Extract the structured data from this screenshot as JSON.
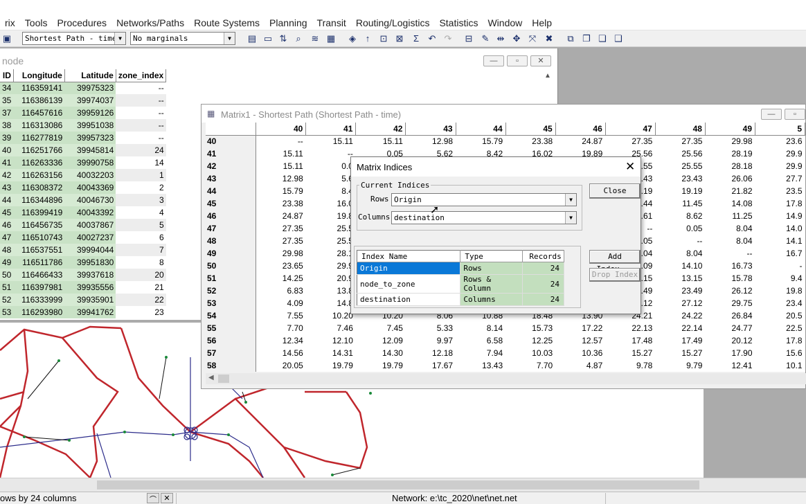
{
  "menubar": [
    "rix",
    "Tools",
    "Procedures",
    "Networks/Paths",
    "Route Systems",
    "Planning",
    "Transit",
    "Routing/Logistics",
    "Statistics",
    "Window",
    "Help"
  ],
  "toolbar": {
    "matrix_select": "Shortest Path - time",
    "marginal_select": "No marginals"
  },
  "node_window": {
    "title": "node",
    "columns": [
      "ID",
      "Longitude",
      "Latitude",
      "zone_index"
    ],
    "rows": [
      [
        "34",
        "116359141",
        "39975323",
        "--"
      ],
      [
        "35",
        "116386139",
        "39974037",
        "--"
      ],
      [
        "37",
        "116457616",
        "39959126",
        "--"
      ],
      [
        "38",
        "116313086",
        "39951038",
        "--"
      ],
      [
        "39",
        "116277819",
        "39957323",
        "--"
      ],
      [
        "40",
        "116251766",
        "39945814",
        "24"
      ],
      [
        "41",
        "116263336",
        "39990758",
        "14"
      ],
      [
        "42",
        "116263156",
        "40032203",
        "1"
      ],
      [
        "43",
        "116308372",
        "40043369",
        "2"
      ],
      [
        "44",
        "116344896",
        "40046730",
        "3"
      ],
      [
        "45",
        "116399419",
        "40043392",
        "4"
      ],
      [
        "46",
        "116456735",
        "40037867",
        "5"
      ],
      [
        "47",
        "116510743",
        "40027237",
        "6"
      ],
      [
        "48",
        "116537551",
        "39994044",
        "7"
      ],
      [
        "49",
        "116511786",
        "39951830",
        "8"
      ],
      [
        "50",
        "116466433",
        "39937618",
        "20"
      ],
      [
        "51",
        "116397981",
        "39935556",
        "21"
      ],
      [
        "52",
        "116333999",
        "39935901",
        "22"
      ],
      [
        "53",
        "116293980",
        "39941762",
        "23"
      ]
    ]
  },
  "matrix_window": {
    "title": "Matrix1 - Shortest Path (Shortest Path - time)",
    "col_headers": [
      "40",
      "41",
      "42",
      "43",
      "44",
      "45",
      "46",
      "47",
      "48",
      "49",
      "5"
    ],
    "rows": [
      {
        "id": "40",
        "vals": [
          "--",
          "15.11",
          "15.11",
          "12.98",
          "15.79",
          "23.38",
          "24.87",
          "27.35",
          "27.35",
          "29.98",
          "23.6"
        ]
      },
      {
        "id": "41",
        "vals": [
          "15.11",
          "--",
          "0.05",
          "5.62",
          "8.42",
          "16.02",
          "19.89",
          "25.56",
          "25.56",
          "28.19",
          "29.9"
        ]
      },
      {
        "id": "42",
        "vals": [
          "15.11",
          "0.0",
          "",
          "",
          "",
          "",
          "",
          "5.55",
          "25.55",
          "28.18",
          "29.9"
        ]
      },
      {
        "id": "43",
        "vals": [
          "12.98",
          "5.6",
          "",
          "",
          "",
          "",
          "",
          "3.43",
          "23.43",
          "26.06",
          "27.7"
        ]
      },
      {
        "id": "44",
        "vals": [
          "15.79",
          "8.4",
          "",
          "",
          "",
          "",
          "",
          "9.19",
          "19.19",
          "21.82",
          "23.5"
        ]
      },
      {
        "id": "45",
        "vals": [
          "23.38",
          "16.0",
          "",
          "",
          "",
          "",
          "",
          "1.44",
          "11.45",
          "14.08",
          "17.8"
        ]
      },
      {
        "id": "46",
        "vals": [
          "24.87",
          "19.8",
          "",
          "",
          "",
          "",
          "",
          "8.61",
          "8.62",
          "11.25",
          "14.9"
        ]
      },
      {
        "id": "47",
        "vals": [
          "27.35",
          "25.5",
          "",
          "",
          "",
          "",
          "",
          "--",
          "0.05",
          "8.04",
          "14.0"
        ]
      },
      {
        "id": "48",
        "vals": [
          "27.35",
          "25.5",
          "",
          "",
          "",
          "",
          "",
          "0.05",
          "--",
          "8.04",
          "14.1"
        ]
      },
      {
        "id": "49",
        "vals": [
          "29.98",
          "28.1",
          "",
          "",
          "",
          "",
          "",
          "8.04",
          "8.04",
          "--",
          "16.7"
        ]
      },
      {
        "id": "50",
        "vals": [
          "23.65",
          "29.9",
          "",
          "",
          "",
          "",
          "",
          "4.09",
          "14.10",
          "16.73",
          "-"
        ]
      },
      {
        "id": "51",
        "vals": [
          "14.25",
          "20.9",
          "",
          "",
          "",
          "",
          "",
          "3.15",
          "13.15",
          "15.78",
          "9.4"
        ]
      },
      {
        "id": "52",
        "vals": [
          "6.83",
          "13.8",
          "",
          "",
          "",
          "",
          "",
          "3.49",
          "23.49",
          "26.12",
          "19.8"
        ]
      },
      {
        "id": "53",
        "vals": [
          "4.09",
          "14.8",
          "",
          "",
          "",
          "",
          "",
          "7.12",
          "27.12",
          "29.75",
          "23.4"
        ]
      },
      {
        "id": "54",
        "vals": [
          "7.55",
          "10.20",
          "10.20",
          "8.06",
          "10.88",
          "18.48",
          "13.90",
          "24.21",
          "24.22",
          "26.84",
          "20.5"
        ]
      },
      {
        "id": "55",
        "vals": [
          "7.70",
          "7.46",
          "7.45",
          "5.33",
          "8.14",
          "15.73",
          "17.22",
          "22.13",
          "22.14",
          "24.77",
          "22.5"
        ]
      },
      {
        "id": "56",
        "vals": [
          "12.34",
          "12.10",
          "12.09",
          "9.97",
          "6.58",
          "12.25",
          "12.57",
          "17.48",
          "17.49",
          "20.12",
          "17.8"
        ]
      },
      {
        "id": "57",
        "vals": [
          "14.56",
          "14.31",
          "14.30",
          "12.18",
          "7.94",
          "10.03",
          "10.36",
          "15.27",
          "15.27",
          "17.90",
          "15.6"
        ]
      },
      {
        "id": "58",
        "vals": [
          "20.05",
          "19.79",
          "19.79",
          "17.67",
          "13.43",
          "7.70",
          "4.87",
          "9.78",
          "9.79",
          "12.41",
          "10.1"
        ]
      }
    ]
  },
  "dialog": {
    "title": "Matrix Indices",
    "group_label": "Current Indices",
    "rows_label": "Rows",
    "rows_value": "Origin",
    "columns_label": "Columns",
    "columns_value": "destination",
    "close_label": "Close",
    "add_index_label": "Add Index...",
    "drop_index_label": "Drop Index",
    "table_headers": [
      "Index Name",
      "Type",
      "Records"
    ],
    "table_rows": [
      [
        "Origin",
        "Rows",
        "24"
      ],
      [
        "node_to_zone",
        "Rows & Column",
        "24"
      ],
      [
        "destination",
        "Columns",
        "24"
      ]
    ]
  },
  "status": {
    "left": "ows by 24 columns",
    "network": "Network: e:\\tc_2020\\net\\net.net"
  }
}
